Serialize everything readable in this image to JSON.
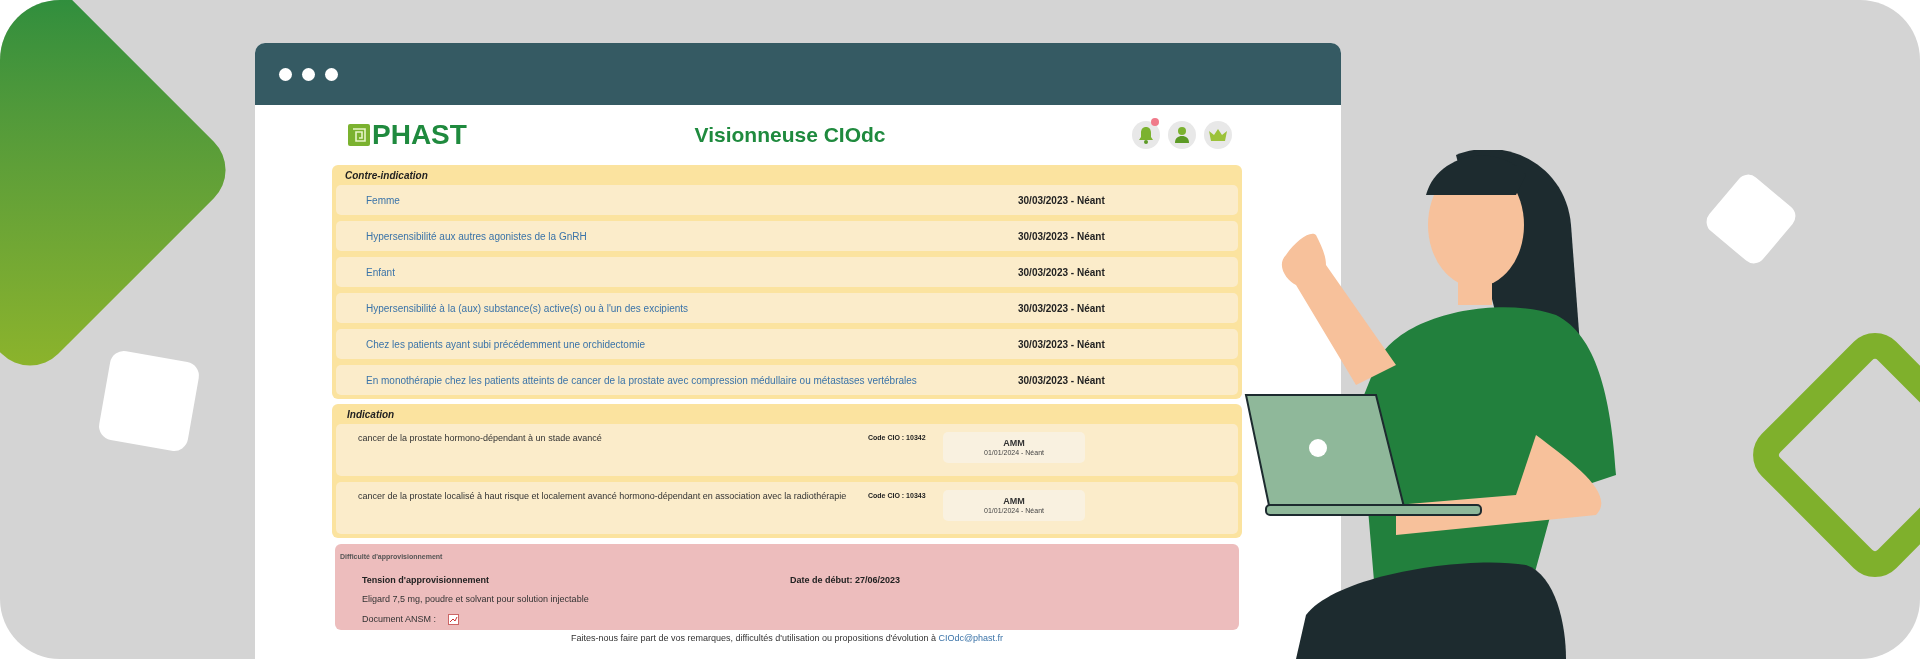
{
  "header": {
    "logo": "PHAST",
    "title": "Visionneuse CIOdc",
    "has_notification": true
  },
  "contraindications": {
    "heading": "Contre-indication",
    "items": [
      {
        "label": "Femme",
        "date": "30/03/2023 - Néant"
      },
      {
        "label": "Hypersensibilité aux autres agonistes de la GnRH",
        "date": "30/03/2023 - Néant"
      },
      {
        "label": "Enfant",
        "date": "30/03/2023 - Néant"
      },
      {
        "label": "Hypersensibilité à la (aux) substance(s) active(s) ou à l'un des excipients",
        "date": "30/03/2023 - Néant"
      },
      {
        "label": "Chez les patients ayant subi précédemment une orchidectomie",
        "date": "30/03/2023 - Néant"
      },
      {
        "label": "En monothérapie chez les patients atteints de cancer de la prostate avec compression médullaire ou métastases vertébrales",
        "date": "30/03/2023 - Néant"
      }
    ]
  },
  "indications": {
    "heading": "Indication",
    "items": [
      {
        "text": "cancer de la prostate hormono-dépendant à un stade avancé",
        "code": "Code CIO : 10342",
        "status": "AMM",
        "date": "01/01/2024 - Néant"
      },
      {
        "text": "cancer de la prostate localisé à haut risque et localement avancé hormono-dépendant en association avec la radiothérapie",
        "code": "Code CIO : 10343",
        "status": "AMM",
        "date": "01/01/2024 - Néant"
      }
    ]
  },
  "supply": {
    "heading": "Difficulté d'approvisionnement",
    "title": "Tension d'approvisionnement",
    "start": "Date de début: 27/06/2023",
    "product": "Eligard 7,5 mg, poudre et solvant pour solution injectable",
    "document_label": "Document ANSM :"
  },
  "footer": {
    "text": "Faites-nous faire part de vos remarques, difficultés d'utilisation ou propositions d'évolution à ",
    "link": "CIOdc@phast.fr"
  }
}
